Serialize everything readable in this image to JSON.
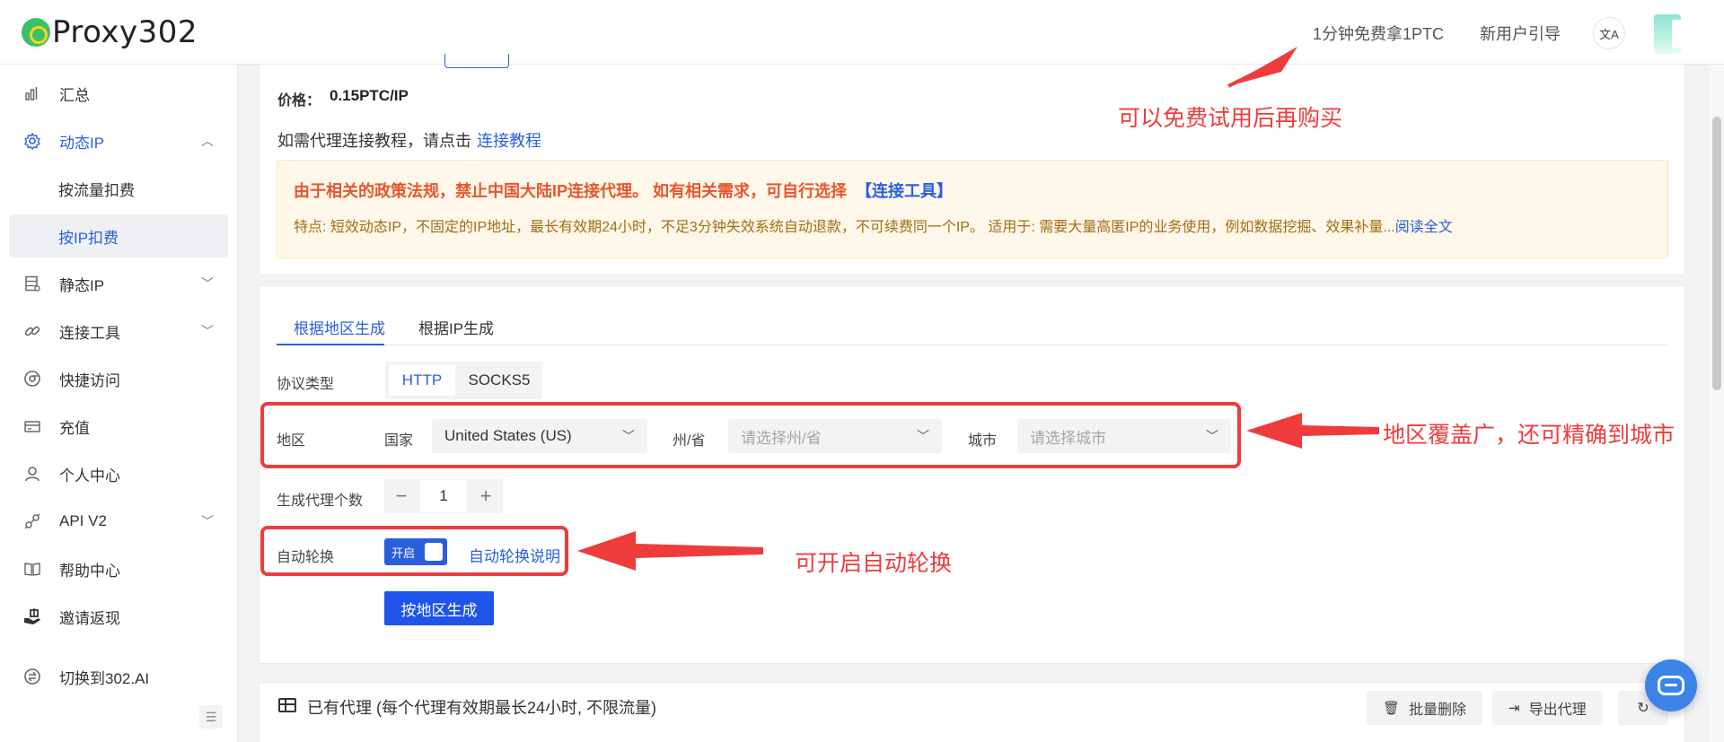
{
  "header": {
    "logo_text": "Proxy302",
    "free_trial_link": "1分钟免费拿1PTC",
    "new_user_guide": "新用户引导",
    "lang_icon": "translate-icon"
  },
  "sidebar": {
    "items": [
      {
        "label": "汇总",
        "icon": "bar-chart-icon"
      },
      {
        "label": "动态IP",
        "icon": "gear-icon"
      },
      {
        "label": "按流量扣费"
      },
      {
        "label": "按IP扣费"
      },
      {
        "label": "静态IP",
        "icon": "server-icon"
      },
      {
        "label": "连接工具",
        "icon": "link-icon"
      },
      {
        "label": "快捷访问",
        "icon": "chrome-icon"
      },
      {
        "label": "充值",
        "icon": "card-icon"
      },
      {
        "label": "个人中心",
        "icon": "user-icon"
      },
      {
        "label": "API V2",
        "icon": "api-icon"
      },
      {
        "label": "帮助中心",
        "icon": "book-icon"
      },
      {
        "label": "邀请返现",
        "icon": "gift-icon"
      },
      {
        "label": "切换到302.AI",
        "icon": "switch-icon"
      }
    ]
  },
  "pricing": {
    "label": "价格：",
    "value": "0.15PTC/IP",
    "tutorial_text": "如需代理连接教程，请点击",
    "tutorial_link": "连接教程"
  },
  "notice": {
    "title": "由于相关的政策法规，禁止中国大陆IP连接代理。 如有相关需求，可自行选择",
    "tool_link": "【连接工具】",
    "body": "特点: 短效动态IP，不固定的IP地址，最长有效期24小时，不足3分钟失效系统自动退款，不可续费同一个IP。 适用于: 需要大量高匿IP的业务使用，例如数据挖掘、效果补量...",
    "read_more": "阅读全文"
  },
  "tabs": [
    {
      "label": "根据地区生成",
      "active": true
    },
    {
      "label": "根据IP生成",
      "active": false
    }
  ],
  "form": {
    "protocol_label": "协议类型",
    "protocol_options": [
      "HTTP",
      "SOCKS5"
    ],
    "protocol_selected": "HTTP",
    "region_label": "地区",
    "country_label": "国家",
    "country_value": "United States (US)",
    "state_label": "州/省",
    "state_placeholder": "请选择州/省",
    "city_label": "城市",
    "city_placeholder": "请选择城市",
    "count_label": "生成代理个数",
    "count_value": "1",
    "rotate_label": "自动轮换",
    "rotate_toggle_text": "开启",
    "rotate_on": true,
    "rotate_help": "自动轮换说明",
    "generate_button": "按地区生成"
  },
  "annotations": {
    "free_trial_note": "可以免费试用后再购买",
    "region_note": "地区覆盖广，还可精确到城市",
    "rotate_note": "可开启自动轮换",
    "color": "#ee3c3c"
  },
  "existing": {
    "title": "已有代理 (每个代理有效期最长24小时, 不限流量)",
    "batch_delete": "批量删除",
    "export": "导出代理"
  },
  "colors": {
    "accent": "#2a5fdc",
    "primary_button": "#1e55e8",
    "notice_bg": "#fff7e9",
    "notice_title": "#e4572e"
  }
}
